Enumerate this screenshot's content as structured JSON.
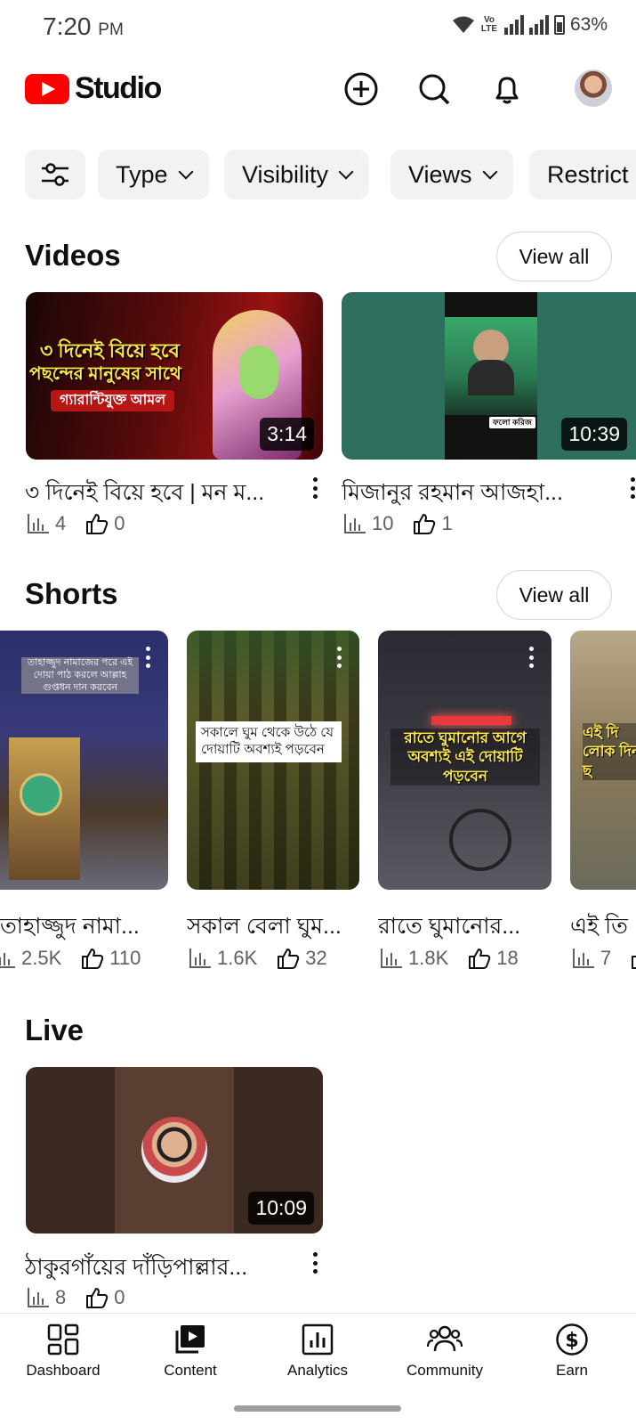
{
  "status_bar": {
    "time": "7:20",
    "ampm": "PM",
    "volte": "Vo LTE",
    "battery": "63%"
  },
  "header": {
    "logo_text": "Studio"
  },
  "chips": [
    "Type",
    "Visibility",
    "Views",
    "Restrict"
  ],
  "videos": {
    "title": "Videos",
    "view_all": "View all",
    "items": [
      {
        "title": "৩ দিনেই বিয়ে হবে | মন ম...",
        "duration": "3:14",
        "views": "4",
        "likes": "0",
        "thumb_text": [
          "৩ দিনেই বিয়ে হবে",
          "পছন্দের মানুষের সাথে",
          "গ্যারান্টিযুক্ত আমল"
        ]
      },
      {
        "title": "মিজানুর রহমান আজহা...",
        "duration": "10:39",
        "views": "10",
        "likes": "1",
        "thumb_text": [
          "ফলো করিজ"
        ]
      }
    ]
  },
  "shorts": {
    "title": "Shorts",
    "view_all": "View all",
    "items": [
      {
        "title": "তাহাজ্জুদ নামা...",
        "views": "2.5K",
        "likes": "110",
        "thumb_text": "তাহাজ্জুদ নামাজের পরে এই দোয়া পাঠ করলে আল্লাহ গুপ্তধন দান করবেন"
      },
      {
        "title": "সকাল বেলা ঘুম...",
        "views": "1.6K",
        "likes": "32",
        "thumb_text": "সকালে ঘুম থেকে উঠে যে দোয়াটি অবশ্যই পড়বেন"
      },
      {
        "title": "রাতে ঘুমানোর...",
        "views": "1.8K",
        "likes": "18",
        "thumb_text": "রাতে ঘুমানোর আগে অবশ্যই এই দোয়াটি পড়বেন"
      },
      {
        "title": "এই তি",
        "views": "7",
        "likes": "",
        "thumb_text": "এই দি লোক দিন ছ"
      }
    ]
  },
  "live": {
    "title": "Live",
    "items": [
      {
        "title": "ঠাকুরগাঁয়ের দাঁড়িপাল্লার...",
        "duration": "10:09",
        "views": "8",
        "likes": "0"
      }
    ]
  },
  "bottom_nav": [
    {
      "label": "Dashboard",
      "icon": "dashboard-icon"
    },
    {
      "label": "Content",
      "icon": "content-icon"
    },
    {
      "label": "Analytics",
      "icon": "analytics-icon"
    },
    {
      "label": "Community",
      "icon": "community-icon"
    },
    {
      "label": "Earn",
      "icon": "earn-icon"
    }
  ],
  "colors": {
    "brand_red": "#ff0000",
    "chip_bg": "#f2f2f2",
    "text": "#0f0f0f",
    "secondary_text": "#606060"
  }
}
